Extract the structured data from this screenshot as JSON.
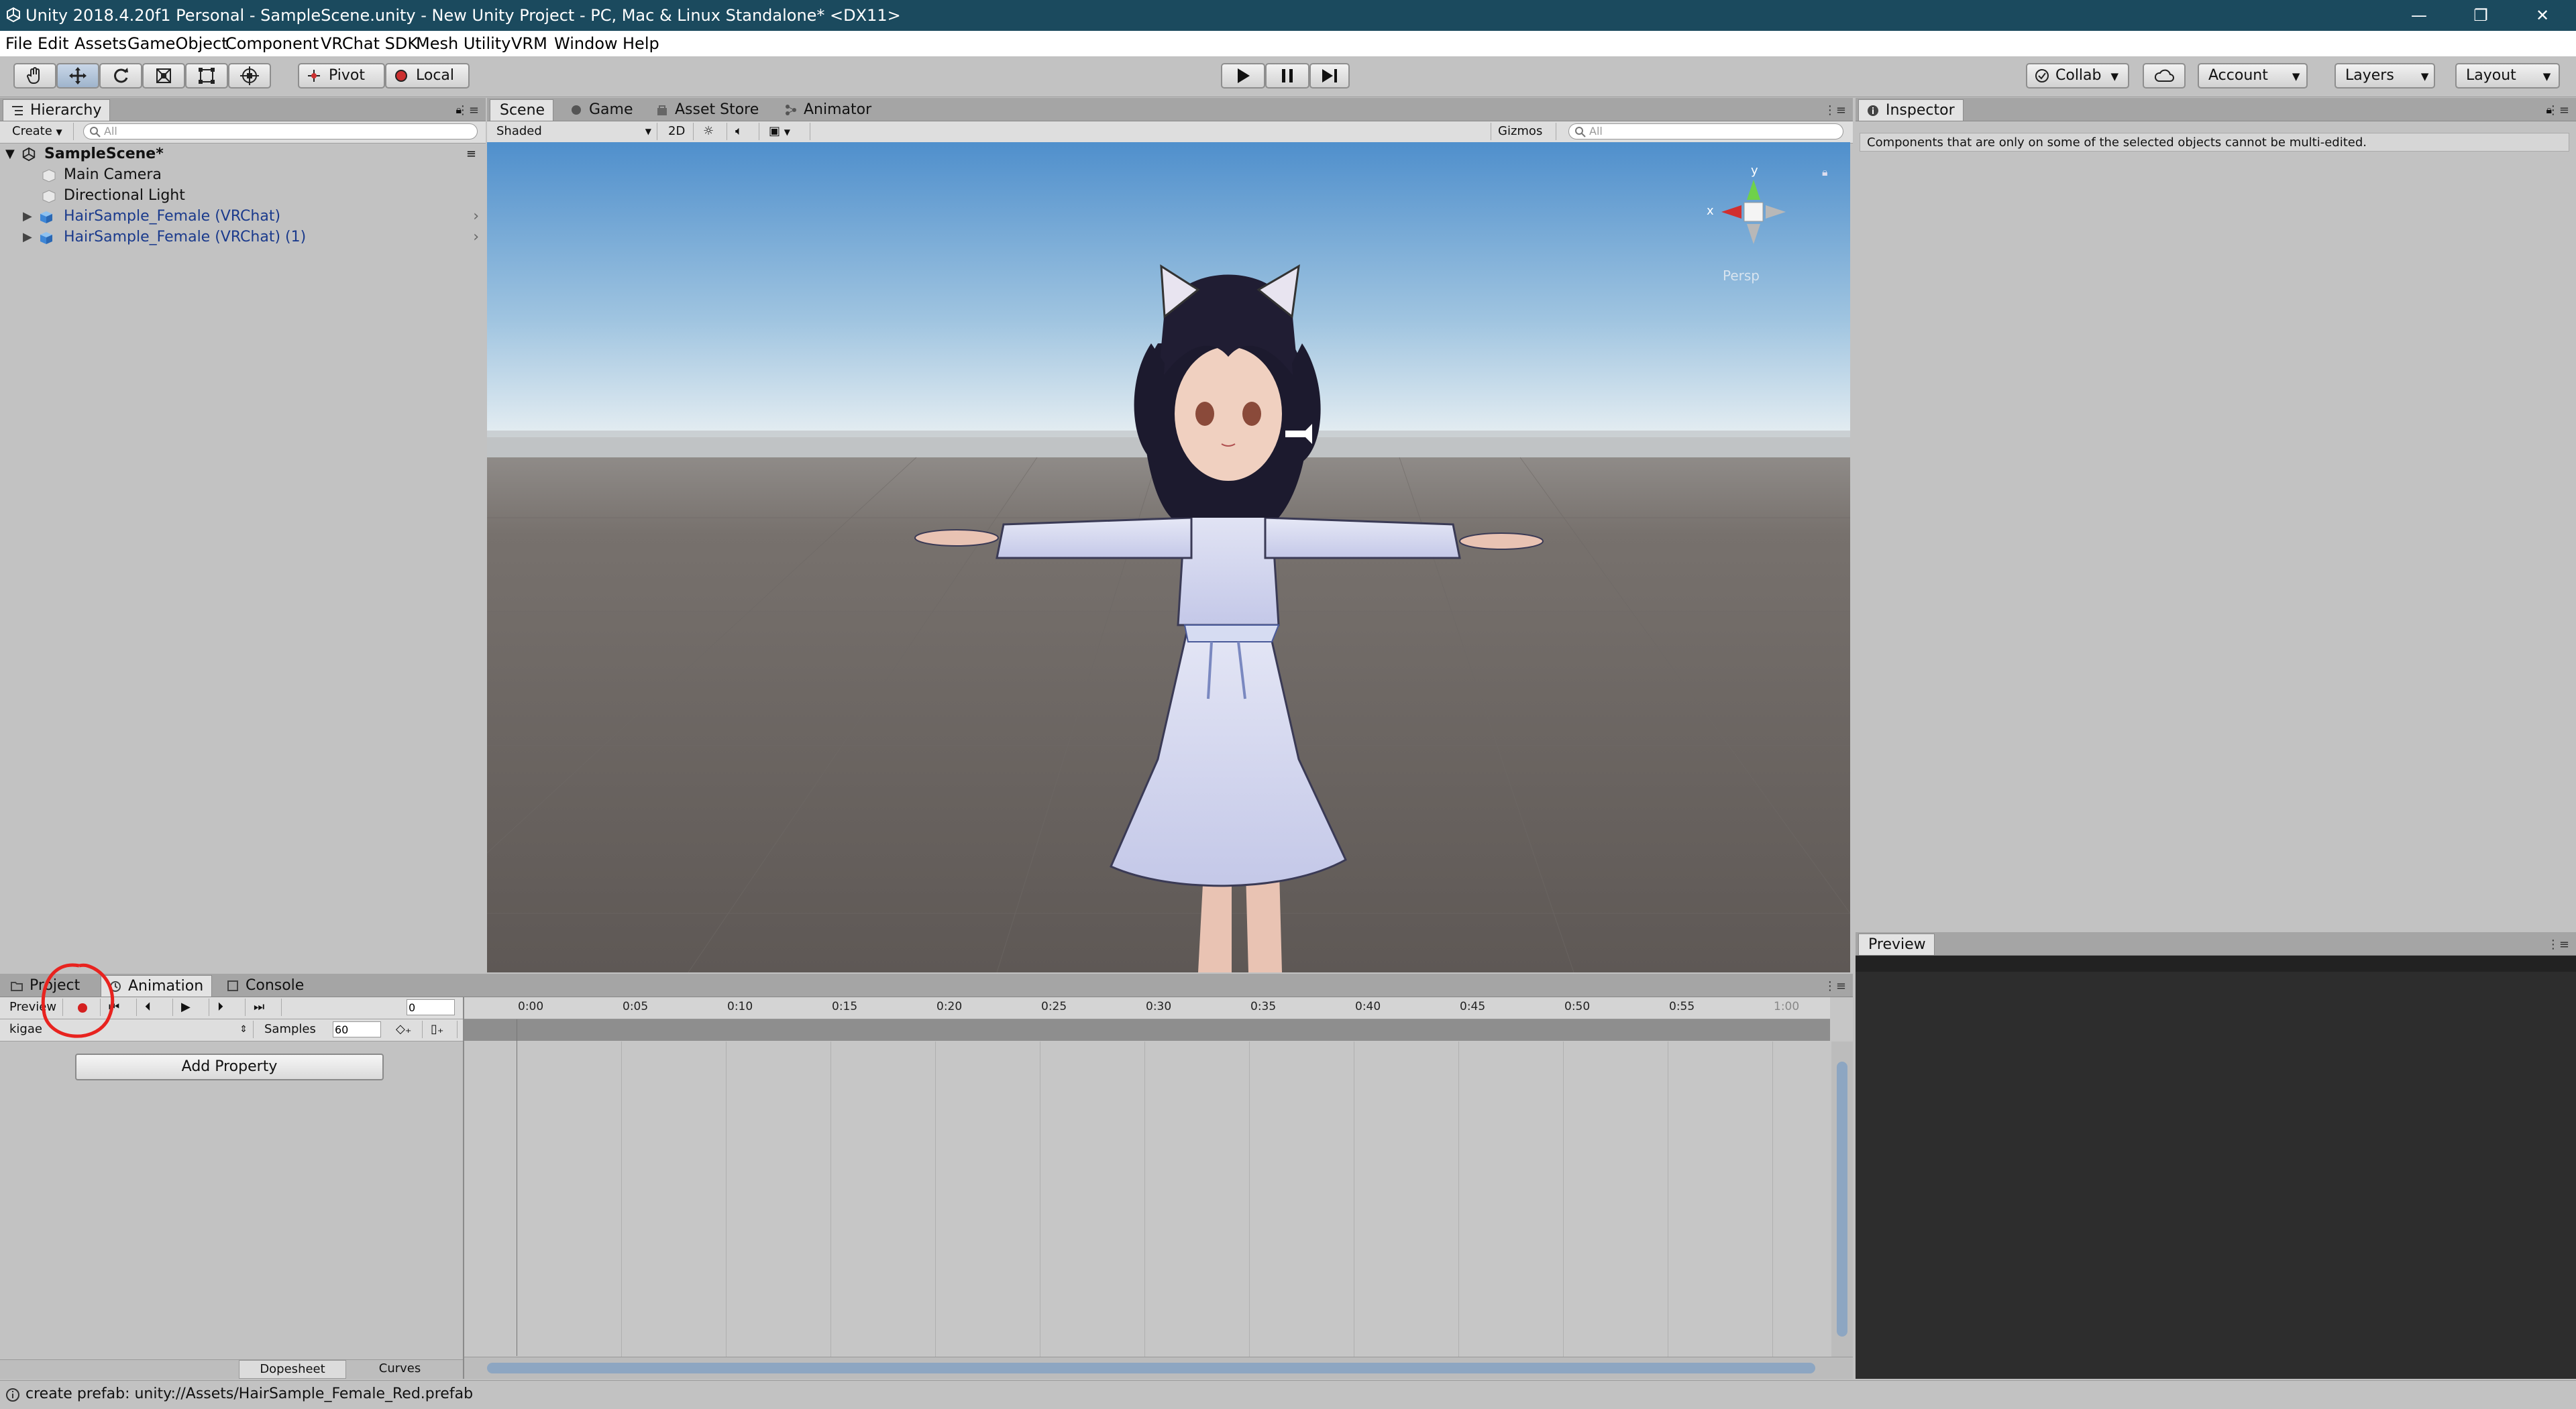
{
  "titlebar": {
    "title": "Unity 2018.4.20f1 Personal - SampleScene.unity - New Unity Project - PC, Mac & Linux Standalone* <DX11>",
    "min": "—",
    "max": "❐",
    "close": "✕"
  },
  "menubar": [
    "File",
    "Edit",
    "Assets",
    "GameObject",
    "Component",
    "VRChat SDK",
    "Mesh Utility",
    "VRM",
    "Window",
    "Help"
  ],
  "toolbar": {
    "tools": [
      "hand-tool",
      "move-tool",
      "rotate-tool",
      "scale-tool",
      "rect-tool",
      "transform-tool"
    ],
    "pivot": "Pivot",
    "local": "Local",
    "collab": "Collab",
    "account": "Account",
    "layers": "Layers",
    "layout": "Layout"
  },
  "hierarchy": {
    "tab": "Hierarchy",
    "create": "Create",
    "search_placeholder": "All",
    "scene": "SampleScene*",
    "items": [
      {
        "label": "Main Camera",
        "prefab": false
      },
      {
        "label": "Directional Light",
        "prefab": false
      },
      {
        "label": "HairSample_Female (VRChat)",
        "prefab": true
      },
      {
        "label": "HairSample_Female (VRChat) (1)",
        "prefab": true
      }
    ]
  },
  "scene_tabs": [
    "Scene",
    "Game",
    "Asset Store",
    "Animator"
  ],
  "scene_toolbar": {
    "shading": "Shaded",
    "mode2d": "2D",
    "gizmos": "Gizmos",
    "search_placeholder": "All"
  },
  "gizmo": {
    "y": "y",
    "x": "x",
    "persp": "Persp"
  },
  "inspector": {
    "tab": "Inspector",
    "message": "Components that are only on some of the selected objects cannot be multi-edited.",
    "preview": "Preview"
  },
  "bottom_tabs": [
    "Project",
    "Animation",
    "Console"
  ],
  "animation": {
    "preview": "Preview",
    "frame": "0",
    "clip": "kigae",
    "samples_label": "Samples",
    "samples": "60",
    "add_property": "Add Property",
    "dopesheet": "Dopesheet",
    "curves": "Curves",
    "ticks": [
      "0:00",
      "0:05",
      "0:10",
      "0:15",
      "0:20",
      "0:25",
      "0:30",
      "0:35",
      "0:40",
      "0:45",
      "0:50",
      "0:55",
      "1:00"
    ]
  },
  "status": "create prefab: unity://Assets/HairSample_Female_Red.prefab",
  "colors": {
    "titlebar": "#1b4a5e",
    "record": "#d42020",
    "annotation": "#e8231f",
    "prefab_text": "#1a3a8c"
  }
}
